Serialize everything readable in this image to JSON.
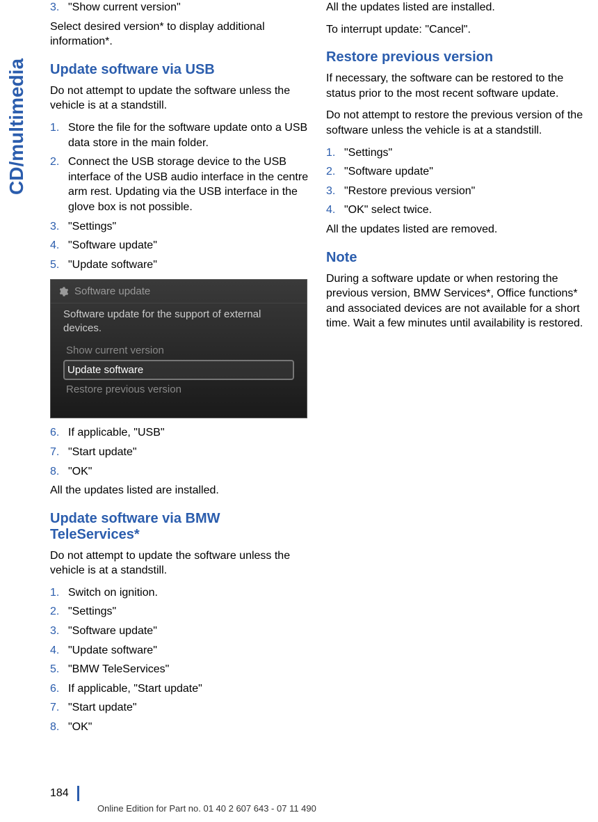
{
  "sidebar": "CD/multimedia",
  "left": {
    "top_item_num": "3.",
    "top_item_text": "\"Show current version\"",
    "top_para": "Select desired version* to display additional information*.",
    "h_usb": "Update software via USB",
    "usb_intro": "Do not attempt to update the software unless the vehicle is at a standstill.",
    "usb_steps": [
      {
        "n": "1.",
        "t": "Store the file for the software update onto a USB data store in the main folder."
      },
      {
        "n": "2.",
        "t": "Connect the USB storage device to the USB interface of the USB audio interface in the centre arm rest. Updating via the USB interface in the glove box is not possible."
      },
      {
        "n": "3.",
        "t": "\"Settings\""
      },
      {
        "n": "4.",
        "t": "\"Software update\""
      },
      {
        "n": "5.",
        "t": "\"Update software\""
      }
    ],
    "screenshot": {
      "title": "Software update",
      "desc": "Software update for the support of external devices.",
      "items": [
        {
          "label": "Show current version",
          "highlighted": false
        },
        {
          "label": "Update software",
          "highlighted": true
        },
        {
          "label": "Restore previous version",
          "highlighted": false
        }
      ]
    },
    "usb_steps2": [
      {
        "n": "6.",
        "t": "If applicable, \"USB\""
      },
      {
        "n": "7.",
        "t": "\"Start update\""
      },
      {
        "n": "8.",
        "t": "\"OK\""
      }
    ],
    "usb_outro": "All the updates listed are installed.",
    "h_tele": "Update software via BMW TeleServices*",
    "tele_intro": "Do not attempt to update the software unless the vehicle is at a standstill.",
    "tele_steps": [
      {
        "n": "1.",
        "t": "Switch on ignition."
      },
      {
        "n": "2.",
        "t": "\"Settings\""
      },
      {
        "n": "3.",
        "t": "\"Software update\""
      },
      {
        "n": "4.",
        "t": "\"Update software\""
      },
      {
        "n": "5.",
        "t": "\"BMW TeleServices\""
      },
      {
        "n": "6.",
        "t": "If applicable, \"Start update\""
      },
      {
        "n": "7.",
        "t": "\"Start update\""
      },
      {
        "n": "8.",
        "t": "\"OK\""
      }
    ]
  },
  "right": {
    "line1": "All the updates listed are installed.",
    "line2": "To interrupt update: \"Cancel\".",
    "h_restore": "Restore previous version",
    "restore_p1": "If necessary, the software can be restored to the status prior to the most recent software update.",
    "restore_p2": "Do not attempt to restore the previous version of the software unless the vehicle is at a standstill.",
    "restore_steps": [
      {
        "n": "1.",
        "t": "\"Settings\""
      },
      {
        "n": "2.",
        "t": "\"Software update\""
      },
      {
        "n": "3.",
        "t": "\"Restore previous version\""
      },
      {
        "n": "4.",
        "t": "\"OK\" select twice."
      }
    ],
    "restore_outro": "All the updates listed are removed.",
    "h_note": "Note",
    "note_text": "During a software update or when restoring the previous version, BMW Services*, Office functions* and associated devices are not available for a short time. Wait a few minutes until availability is restored."
  },
  "footer": {
    "page": "184",
    "text": "Online Edition for Part no. 01 40 2 607 643 - 07 11 490"
  }
}
